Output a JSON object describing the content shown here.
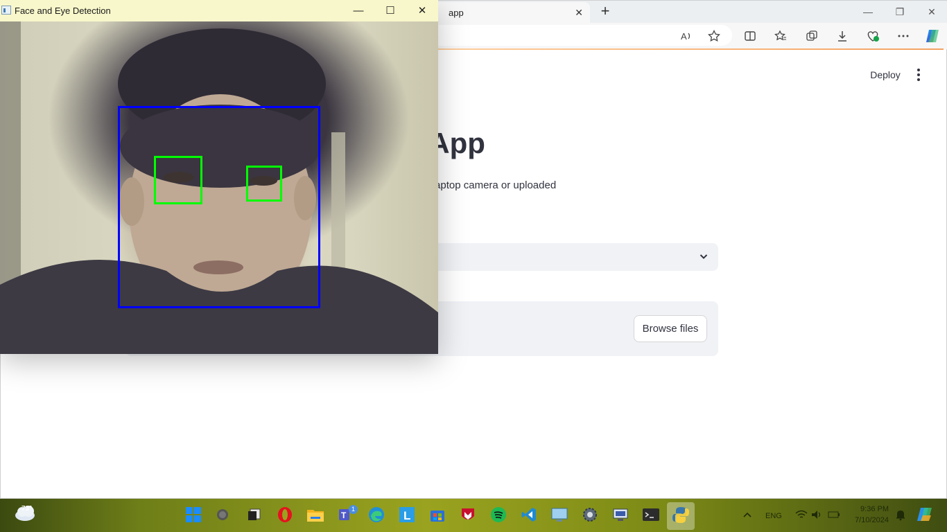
{
  "browser": {
    "tab_title": "app",
    "tab_close": "✕",
    "new_tab": "+",
    "window_controls": {
      "minimize": "—",
      "restore": "❐",
      "close": "✕"
    }
  },
  "streamlit": {
    "deploy_label": "Deploy",
    "title_visible": "etection App",
    "description_visible": "scades in real-time from your laptop camera or uploaded",
    "browse_files_label": "Browse files"
  },
  "camera_window": {
    "title": "Face and Eye Detection",
    "controls": {
      "minimize": "—",
      "maximize": "☐",
      "close": "✕"
    },
    "detections": {
      "face_color": "#0000ff",
      "eye_color": "#00ff00"
    }
  },
  "taskbar": {
    "weather_temp": "73°",
    "teams_badge": "1",
    "language": "ENG",
    "time": "9:36 PM",
    "date": "7/10/2024",
    "apps": [
      "start-icon",
      "search-icon",
      "task-view-icon",
      "opera-icon",
      "file-explorer-icon",
      "teams-icon",
      "edge-icon",
      "l-app-icon",
      "store-icon",
      "mcafee-icon",
      "spotify-icon",
      "vscode-icon",
      "remote-desktop-icon",
      "settings-icon",
      "network-app-icon",
      "terminal-icon",
      "python-icon"
    ]
  },
  "colors": {
    "streamlit_text": "#31333f",
    "widget_bg": "#f0f2f6",
    "cam_titlebar": "#f8f7cb"
  }
}
